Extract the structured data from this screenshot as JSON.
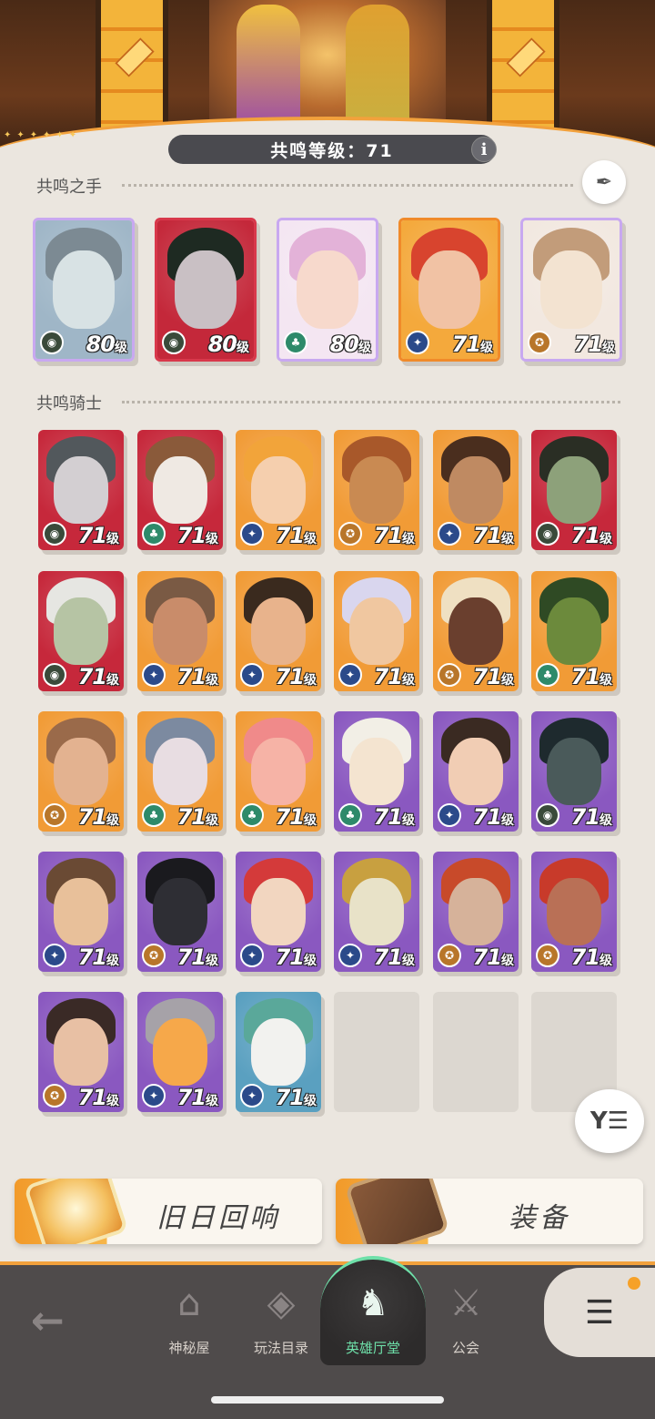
{
  "header": {
    "resonance_level_label": "共鸣等级：71",
    "info_label": "i"
  },
  "hands_section": {
    "title": "共鸣之手"
  },
  "knights_section": {
    "title": "共鸣骑士"
  },
  "level_suffix": "级",
  "hands": [
    {
      "level": "80",
      "faction": "graveborn",
      "bg": "#9fb6c7",
      "frame": "#c8a8f0",
      "skin": "#d8e2e4",
      "hair": "#7c8a93"
    },
    {
      "level": "80",
      "faction": "graveborn",
      "bg": "#c4283a",
      "frame": "#d8384b",
      "skin": "#c9c0c4",
      "hair": "#1e2a22"
    },
    {
      "level": "80",
      "faction": "wilder",
      "bg": "#f4e6f2",
      "frame": "#c8a8f0",
      "skin": "#f7d9cc",
      "hair": "#e3b2d8"
    },
    {
      "level": "71",
      "faction": "lightbearer",
      "bg": "#f4a93c",
      "frame": "#f08a2a",
      "skin": "#f1c2a4",
      "hair": "#d8442e"
    },
    {
      "level": "71",
      "faction": "mauler",
      "bg": "#f2e8e0",
      "frame": "#c8a8f0",
      "skin": "#f3e3d1",
      "hair": "#c29c7a"
    }
  ],
  "knights": [
    {
      "level": "71",
      "faction": "graveborn",
      "bg": "#c6283b",
      "skin": "#d3cfd2",
      "hair": "#52585c"
    },
    {
      "level": "71",
      "faction": "wilder",
      "bg": "#c6283b",
      "skin": "#efe9e3",
      "hair": "#8a5a3a"
    },
    {
      "level": "71",
      "faction": "lightbearer",
      "bg": "#f19b36",
      "skin": "#f5cfae",
      "hair": "#f2a43a"
    },
    {
      "level": "71",
      "faction": "mauler",
      "bg": "#f19b36",
      "skin": "#c98a52",
      "hair": "#a8582a"
    },
    {
      "level": "71",
      "faction": "lightbearer",
      "bg": "#f19b36",
      "skin": "#bf8a62",
      "hair": "#4a2e1e"
    },
    {
      "level": "71",
      "faction": "graveborn",
      "bg": "#c6283b",
      "skin": "#8da17a",
      "hair": "#2a2e24"
    },
    {
      "level": "71",
      "faction": "graveborn",
      "bg": "#c6283b",
      "skin": "#b6c4a4",
      "hair": "#e6e6e2"
    },
    {
      "level": "71",
      "faction": "lightbearer",
      "bg": "#f19b36",
      "skin": "#c98c6a",
      "hair": "#7a5a44"
    },
    {
      "level": "71",
      "faction": "lightbearer",
      "bg": "#f19b36",
      "skin": "#e8b38c",
      "hair": "#3a2a1e"
    },
    {
      "level": "71",
      "faction": "lightbearer",
      "bg": "#f19b36",
      "skin": "#f0c7a0",
      "hair": "#d9d6ee"
    },
    {
      "level": "71",
      "faction": "mauler",
      "bg": "#f19b36",
      "skin": "#6a3f2e",
      "hair": "#efe0c2"
    },
    {
      "level": "71",
      "faction": "wilder",
      "bg": "#f19b36",
      "skin": "#6c8a3c",
      "hair": "#2f4a24"
    },
    {
      "level": "71",
      "faction": "mauler",
      "bg": "#f19b36",
      "skin": "#e3b290",
      "hair": "#9a6a4a"
    },
    {
      "level": "71",
      "faction": "wilder",
      "bg": "#f19b36",
      "skin": "#e8dde2",
      "hair": "#7c8aa0"
    },
    {
      "level": "71",
      "faction": "wilder",
      "bg": "#f19b36",
      "skin": "#f6b3a6",
      "hair": "#f08a8a"
    },
    {
      "level": "71",
      "faction": "wilder",
      "bg": "#8a58c0",
      "skin": "#f4e4d0",
      "hair": "#f2efe6"
    },
    {
      "level": "71",
      "faction": "lightbearer",
      "bg": "#8a58c0",
      "skin": "#f1cdb4",
      "hair": "#3a2a22"
    },
    {
      "level": "71",
      "faction": "graveborn",
      "bg": "#8a58c0",
      "skin": "#4a5a5a",
      "hair": "#1e2a2e"
    },
    {
      "level": "71",
      "faction": "lightbearer",
      "bg": "#8a58c0",
      "skin": "#e8c09a",
      "hair": "#6a4a34"
    },
    {
      "level": "71",
      "faction": "mauler",
      "bg": "#8a58c0",
      "skin": "#2e2e34",
      "hair": "#1a1a1e"
    },
    {
      "level": "71",
      "faction": "lightbearer",
      "bg": "#8a58c0",
      "skin": "#f2d6c0",
      "hair": "#d43a3a"
    },
    {
      "level": "71",
      "faction": "lightbearer",
      "bg": "#8a58c0",
      "skin": "#e8e2c8",
      "hair": "#c8a040"
    },
    {
      "level": "71",
      "faction": "mauler",
      "bg": "#8a58c0",
      "skin": "#d6b29a",
      "hair": "#c84a2a"
    },
    {
      "level": "71",
      "faction": "mauler",
      "bg": "#8a58c0",
      "skin": "#b97056",
      "hair": "#c83a2a"
    },
    {
      "level": "71",
      "faction": "mauler",
      "bg": "#8a58c0",
      "skin": "#e8c0a4",
      "hair": "#3a2a26"
    },
    {
      "level": "71",
      "faction": "lightbearer",
      "bg": "#8a58c0",
      "skin": "#f6a84a",
      "hair": "#a6a2a8"
    },
    {
      "level": "71",
      "faction": "lightbearer",
      "bg": "#5aa0c0",
      "skin": "#f2f2ef",
      "hair": "#5aa89a"
    }
  ],
  "empty_slots": 3,
  "buttons": {
    "echoes_label": "旧日回响",
    "equipment_label": "装备"
  },
  "nav": {
    "items": [
      {
        "label": "神秘屋",
        "icon": "mystery-house-icon"
      },
      {
        "label": "玩法目录",
        "icon": "game-modes-icon"
      },
      {
        "label": "英雄厅堂",
        "icon": "hero-hall-icon",
        "active": true
      },
      {
        "label": "公会",
        "icon": "guild-icon"
      }
    ]
  },
  "colors": {
    "accent": "#f2a13c",
    "nav_active": "#6ee0a9",
    "nav_bg": "#4f4b4b",
    "page_bg": "#ebe6df"
  }
}
